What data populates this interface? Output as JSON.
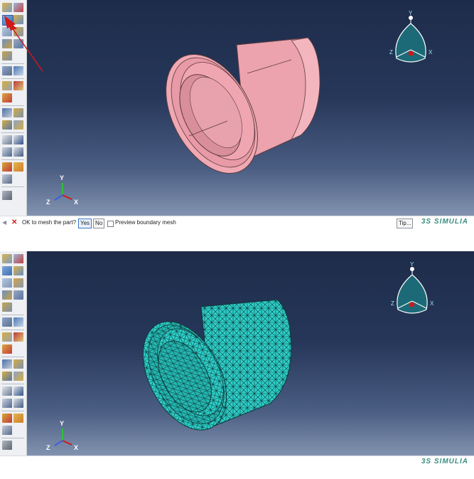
{
  "top": {
    "prompt": {
      "text": "OK to mesh the part?",
      "yes_label": "Yes",
      "no_label": "No",
      "checkbox_label": "Preview boundary mesh",
      "tip_label": "Tip..."
    },
    "brand": "3S SIMULIA",
    "triad": {
      "y": "Y",
      "z": "Z",
      "x": "X"
    },
    "viewcube": {
      "y": "Y",
      "z": "Z",
      "x": "X"
    },
    "part_color": "#f0a6b1",
    "part_state": "unmeshed"
  },
  "bottom": {
    "brand": "3S SIMULIA",
    "triad": {
      "y": "Y",
      "z": "Z",
      "x": "X"
    },
    "viewcube": {
      "y": "Y",
      "z": "Z",
      "x": "X"
    },
    "mesh_color": "#2ecfc9",
    "part_state": "meshed"
  },
  "colors": {
    "viewport_top": "#1e2c4a",
    "viewport_bottom": "#8293b0",
    "annotation_arrow": "#d01919",
    "cancel_x": "#cc1f1f",
    "brand": "#3b8e82"
  }
}
